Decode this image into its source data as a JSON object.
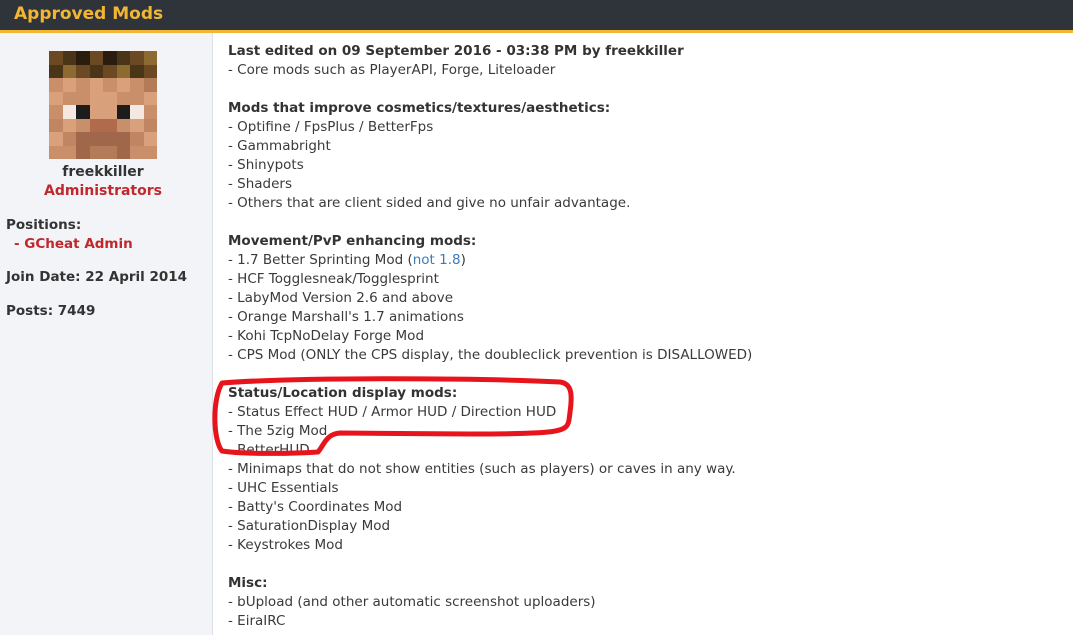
{
  "header": {
    "title": "Approved Mods"
  },
  "author": {
    "username": "freekkiller",
    "usergroup": "Administrators",
    "positions_label": "Positions:",
    "positions_value": "- GCheat Admin",
    "join_date": "Join Date: 22 April 2014",
    "posts": "Posts: 7449"
  },
  "post": {
    "edited": "Last edited on 09 September 2016 - 03:38 PM by freekkiller",
    "core": "- Core mods such as PlayerAPI, Forge, Liteloader",
    "cosmetics": {
      "heading": "Mods that improve cosmetics/textures/aesthetics:",
      "items": [
        "- Optifine / FpsPlus / BetterFps",
        "- Gammabright",
        "- Shinypots",
        "- Shaders",
        "- Others that are client sided and give no unfair advantage."
      ]
    },
    "movement": {
      "heading": "Movement/PvP enhancing mods:",
      "item0_prefix": "- 1.7 Better Sprinting Mod (",
      "item0_link": "not 1.8",
      "item0_suffix": ")",
      "items": [
        "- HCF Togglesneak/Togglesprint",
        "- LabyMod Version 2.6 and above",
        "- Orange Marshall's 1.7 animations",
        "- Kohi TcpNoDelay Forge Mod",
        "- CPS Mod (ONLY the CPS display, the doubleclick prevention is DISALLOWED)"
      ]
    },
    "status": {
      "heading": "Status/Location display mods:",
      "items": [
        "- Status Effect HUD / Armor HUD / Direction HUD",
        "- The 5zig Mod",
        "- BetterHUD",
        "- Minimaps that do not show entities (such as players) or caves in any way.",
        "- UHC Essentials",
        "- Batty's Coordinates Mod",
        "- SaturationDisplay Mod",
        "- Keystrokes Mod"
      ]
    },
    "misc": {
      "heading": "Misc:",
      "items": [
        "- bUpload (and other automatic screenshot uploaders)",
        "- EiraIRC"
      ]
    }
  },
  "colors": {
    "header_bg": "#2f343b",
    "accent": "#f2b632",
    "group_red": "#c0282d",
    "annotation_red": "#e8141c"
  },
  "avatar_pixels": [
    [
      "#6b4a23",
      "#4a3519",
      "#2b1d0e",
      "#6b4a23",
      "#2b1d0e",
      "#4a3519",
      "#6b4a23",
      "#8c6a30"
    ],
    [
      "#4a3519",
      "#8c6a30",
      "#6b4a23",
      "#4a3519",
      "#6b4a23",
      "#8c6a30",
      "#4a3519",
      "#6b4a23"
    ],
    [
      "#c98f6b",
      "#d9a07c",
      "#c98f6b",
      "#d9a07c",
      "#c98f6b",
      "#d9a07c",
      "#c98f6b",
      "#b47b58"
    ],
    [
      "#d9a07c",
      "#c98f6b",
      "#c98f6b",
      "#d9a07c",
      "#d9a07c",
      "#c98f6b",
      "#c98f6b",
      "#d9a07c"
    ],
    [
      "#c98f6b",
      "#f4e8e0",
      "#1c1c1c",
      "#d9a07c",
      "#d9a07c",
      "#1c1c1c",
      "#f4e8e0",
      "#c98f6b"
    ],
    [
      "#c08563",
      "#d9a07c",
      "#c98f6b",
      "#b06b4c",
      "#b06b4c",
      "#c98f6b",
      "#d9a07c",
      "#c08563"
    ],
    [
      "#d9a07c",
      "#c08563",
      "#a0674a",
      "#a0674a",
      "#a0674a",
      "#a0674a",
      "#c08563",
      "#d9a07c"
    ],
    [
      "#c98f6b",
      "#c98f6b",
      "#a0674a",
      "#b47b58",
      "#b47b58",
      "#a0674a",
      "#c98f6b",
      "#c98f6b"
    ]
  ]
}
